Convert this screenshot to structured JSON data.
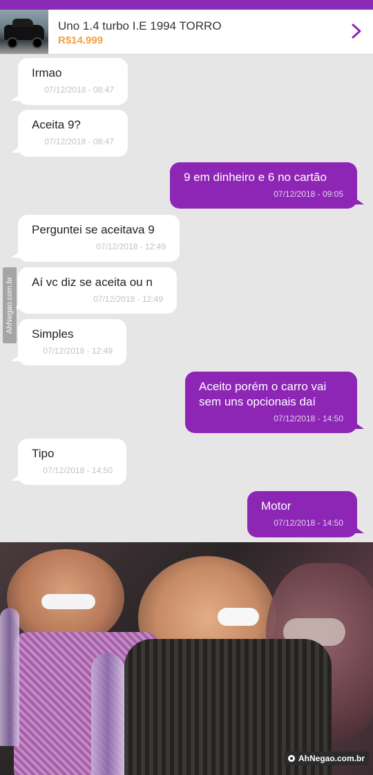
{
  "listing": {
    "title": "Uno 1.4 turbo I.E 1994 TORRO",
    "price": "R$14.999"
  },
  "messages": [
    {
      "dir": "in",
      "text": "Irmao",
      "time": "07/12/2018 - 08:47"
    },
    {
      "dir": "in",
      "text": "Aceita 9?",
      "time": "07/12/2018 - 08:47"
    },
    {
      "dir": "out",
      "text": "9 em dinheiro e 6 no cartão",
      "time": "07/12/2018 - 09:05"
    },
    {
      "dir": "in",
      "text": "Perguntei se aceitava 9",
      "time": "07/12/2018 - 12:49"
    },
    {
      "dir": "in",
      "text": "Aí vc diz se aceita ou n",
      "time": "07/12/2018 - 12:49"
    },
    {
      "dir": "in",
      "text": "Simples",
      "time": "07/12/2018 - 12:49"
    },
    {
      "dir": "out",
      "text": "Aceito porém o carro vai\nsem uns opcionais daí",
      "time": "07/12/2018 - 14:50"
    },
    {
      "dir": "in",
      "text": "Tipo",
      "time": "07/12/2018 - 14:50"
    },
    {
      "dir": "out",
      "text": "Motor",
      "time": "07/12/2018 - 14:50"
    }
  ],
  "watermark": {
    "side": "AhNegao.com.br",
    "bottom": "AhNegao.com.br"
  },
  "colors": {
    "accent": "#8d25b5",
    "price": "#f0a048",
    "background": "#e6e6e6"
  },
  "icons": {
    "chevron": "chevron-right-icon"
  }
}
